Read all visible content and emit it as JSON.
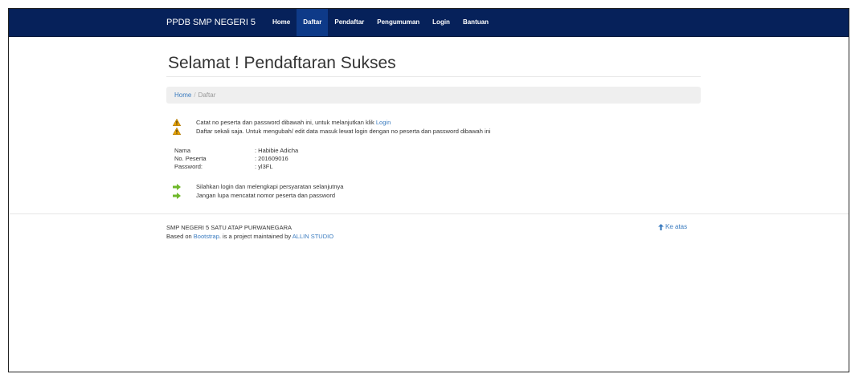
{
  "navbar": {
    "brand": "PPDB SMP NEGERI 5",
    "items": [
      {
        "label": "Home",
        "active": false
      },
      {
        "label": "Daftar",
        "active": true
      },
      {
        "label": "Pendaftar",
        "active": false
      },
      {
        "label": "Pengumuman",
        "active": false
      },
      {
        "label": "Login",
        "active": false
      },
      {
        "label": "Bantuan",
        "active": false
      }
    ]
  },
  "page": {
    "title": "Selamat ! Pendaftaran Sukses"
  },
  "breadcrumb": {
    "home": "Home",
    "separator": "/",
    "current": "Daftar"
  },
  "notices": {
    "line1_text": "Catat no peserta dan password dibawah ini, untuk melanjutkan klik ",
    "line1_link": "Login",
    "line2_text": "Daftar sekali saja. Untuk mengubah/ edit data masuk lewat login dengan no peserta dan password dibawah ini",
    "icon": "warning-icon",
    "icon_color": "#e8a300"
  },
  "info": {
    "name_label": "Nama",
    "name_value": ": Habibie Adicha",
    "id_label": "No. Peserta",
    "id_value": ": 201609016",
    "pw_label": "Password:",
    "pw_value": ": yl3FL"
  },
  "next_steps": {
    "step1": "Silahkan login dan melengkapi persyaratan selanjutnya",
    "step2": "Jangan lupa mencatat nomor peserta dan password",
    "icon": "arrow-right-icon",
    "icon_color": "#6fb82b"
  },
  "footer": {
    "school": "SMP NEGERI 5 SATU ATAP PURWANEGARA",
    "based_on": "Based on ",
    "bootstrap_link": "Bootstrap",
    "middle": ". is a project maintained by ",
    "studio_link": "ALLIN STUDIO",
    "to_top": "Ke atas"
  },
  "colors": {
    "navbar_bg": "#06215a",
    "active_nav_bg": "#0e3a88",
    "link": "#3a7bbf",
    "breadcrumb_bg": "#efefef"
  }
}
